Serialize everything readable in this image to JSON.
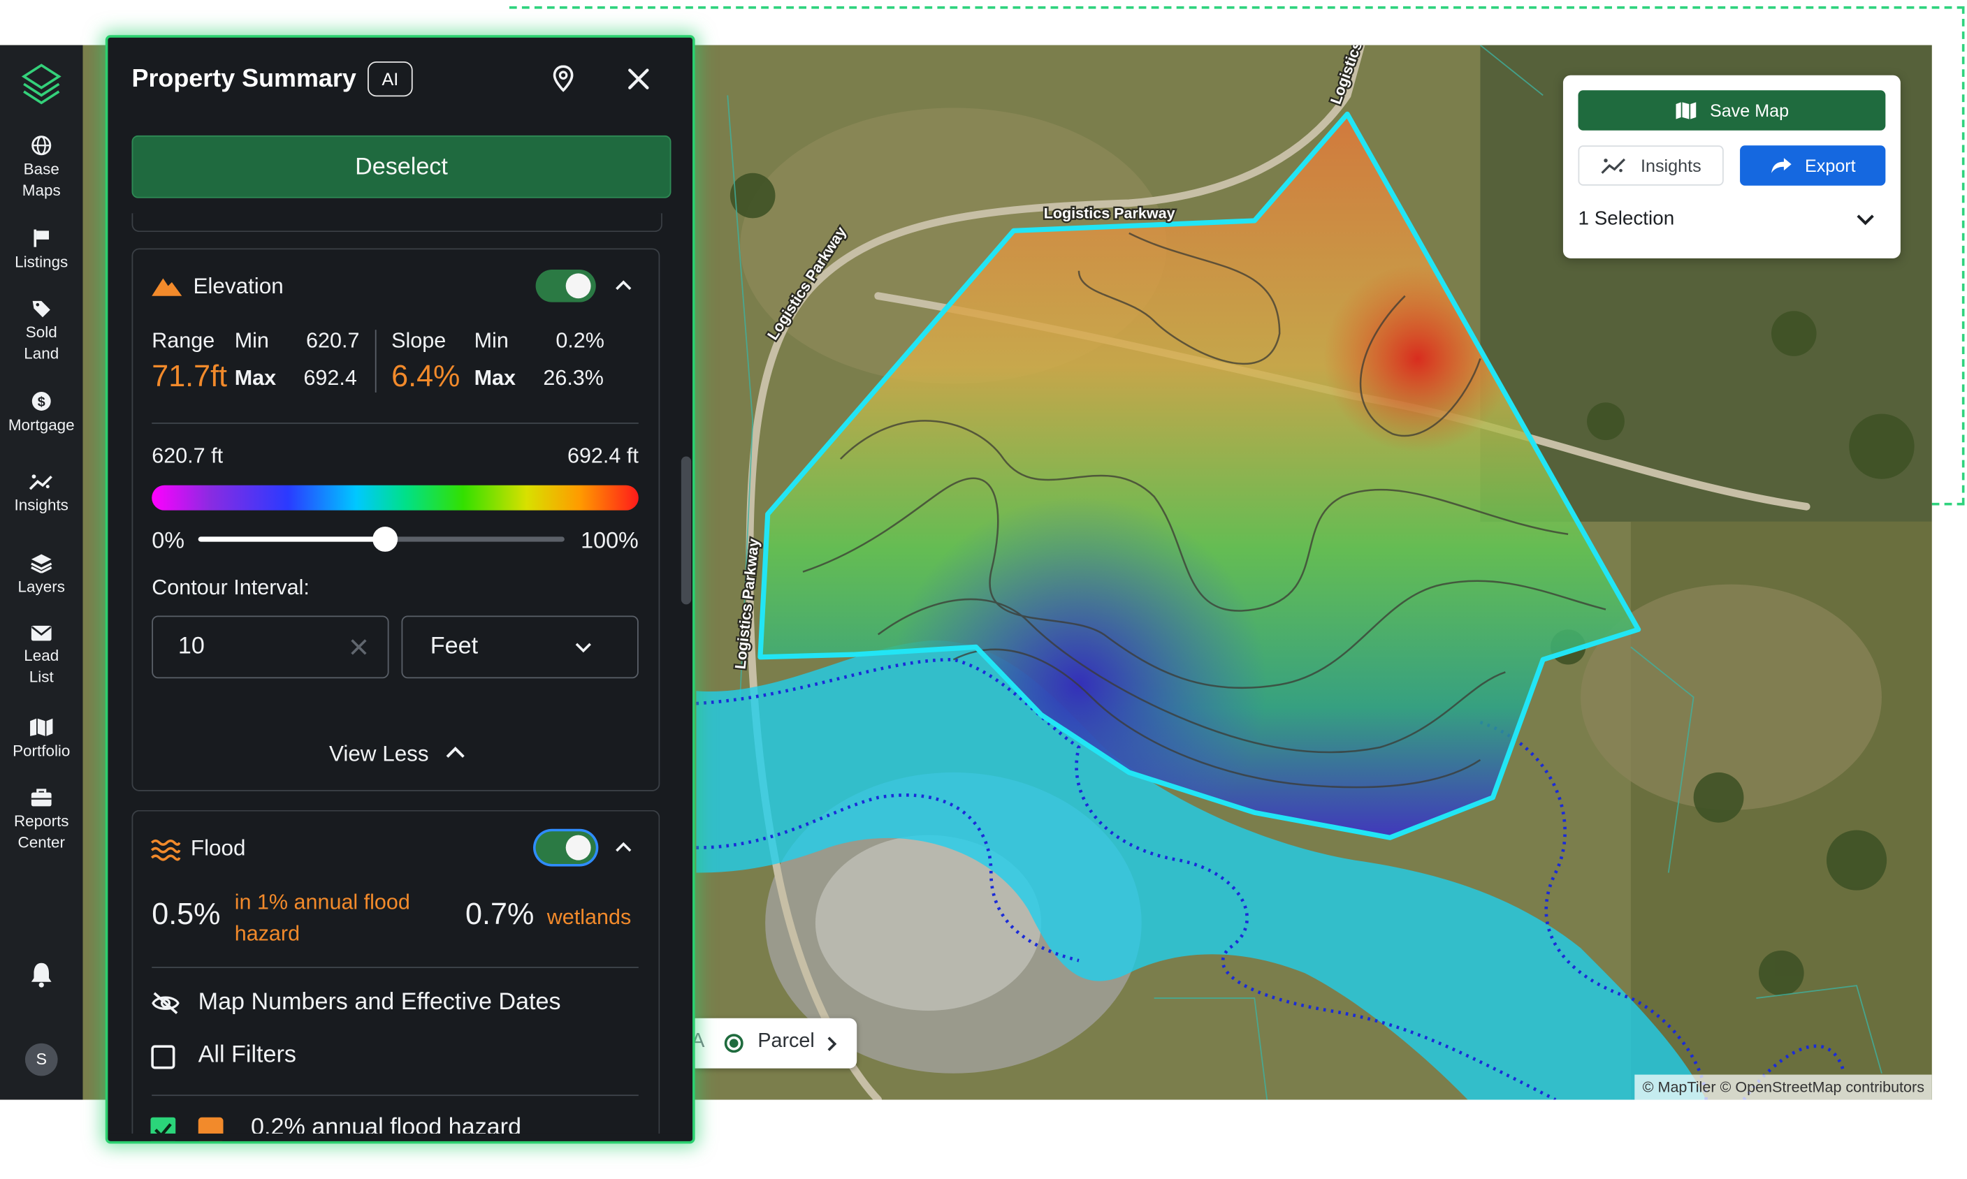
{
  "sidebar": {
    "items": [
      {
        "icon": "globe-icon",
        "label_line1": "Base",
        "label_line2": "Maps"
      },
      {
        "icon": "flag-icon",
        "label_line1": "Listings",
        "label_line2": ""
      },
      {
        "icon": "tag-icon",
        "label_line1": "Sold",
        "label_line2": "Land"
      },
      {
        "icon": "dollar-icon",
        "label_line1": "Mortgage",
        "label_line2": ""
      },
      {
        "icon": "sparkle-chart-icon",
        "label_line1": "Insights",
        "label_line2": ""
      },
      {
        "icon": "layers-icon",
        "label_line1": "Layers",
        "label_line2": ""
      },
      {
        "icon": "envelope-icon",
        "label_line1": "Lead",
        "label_line2": "List"
      },
      {
        "icon": "map-icon",
        "label_line1": "Portfolio",
        "label_line2": ""
      },
      {
        "icon": "briefcase-icon",
        "label_line1": "Reports",
        "label_line2": "Center"
      }
    ],
    "avatar_initial": "S"
  },
  "panel": {
    "title": "Property Summary",
    "ai_badge": "AI",
    "deselect_label": "Deselect",
    "elevation": {
      "title": "Elevation",
      "enabled": true,
      "range_label": "Range",
      "range_value": "71.7ft",
      "range_min_label": "Min",
      "range_min_value": "620.7",
      "range_max_label": "Max",
      "range_max_value": "692.4",
      "slope_label": "Slope",
      "slope_value": "6.4%",
      "slope_min_label": "Min",
      "slope_min_value": "0.2%",
      "slope_max_label": "Max",
      "slope_max_value": "26.3%",
      "scale_low": "620.7 ft",
      "scale_high": "692.4 ft",
      "opacity_min_label": "0%",
      "opacity_max_label": "100%",
      "opacity_value": 0.51,
      "contour_label": "Contour Interval:",
      "contour_value": "10",
      "contour_unit": "Feet",
      "view_less_label": "View Less"
    },
    "flood": {
      "title": "Flood",
      "enabled": true,
      "hazard_percent": "0.5%",
      "hazard_text_line1": "in 1% annual flood",
      "hazard_text_line2": "hazard",
      "wetlands_percent": "0.7%",
      "wetlands_text": "wetlands",
      "map_numbers_label": "Map Numbers and Effective Dates",
      "all_filters_label": "All Filters",
      "all_filters_checked": false,
      "partial_item_label": "0.2% annual flood hazard",
      "partial_item_checked": true
    }
  },
  "map_controls": {
    "save_map_label": "Save Map",
    "insights_label": "Insights",
    "export_label": "Export",
    "selection_label": "1 Selection"
  },
  "map": {
    "road_labels": [
      "Logistics Parkway",
      "Logistics Parkway",
      "Logistics Parkway",
      "Logistics"
    ],
    "parcel_prefix": "A",
    "parcel_label": "Parcel",
    "attribution": "© MapTiler © OpenStreetMap contributors"
  },
  "colors": {
    "accent_green": "#1f6b3e",
    "highlight_green": "#2bd06f",
    "export_blue": "#1568e0",
    "orange": "#f28a2b",
    "flood_cyan": "#1fd0ee",
    "parcel_outline": "#22e5f5"
  }
}
